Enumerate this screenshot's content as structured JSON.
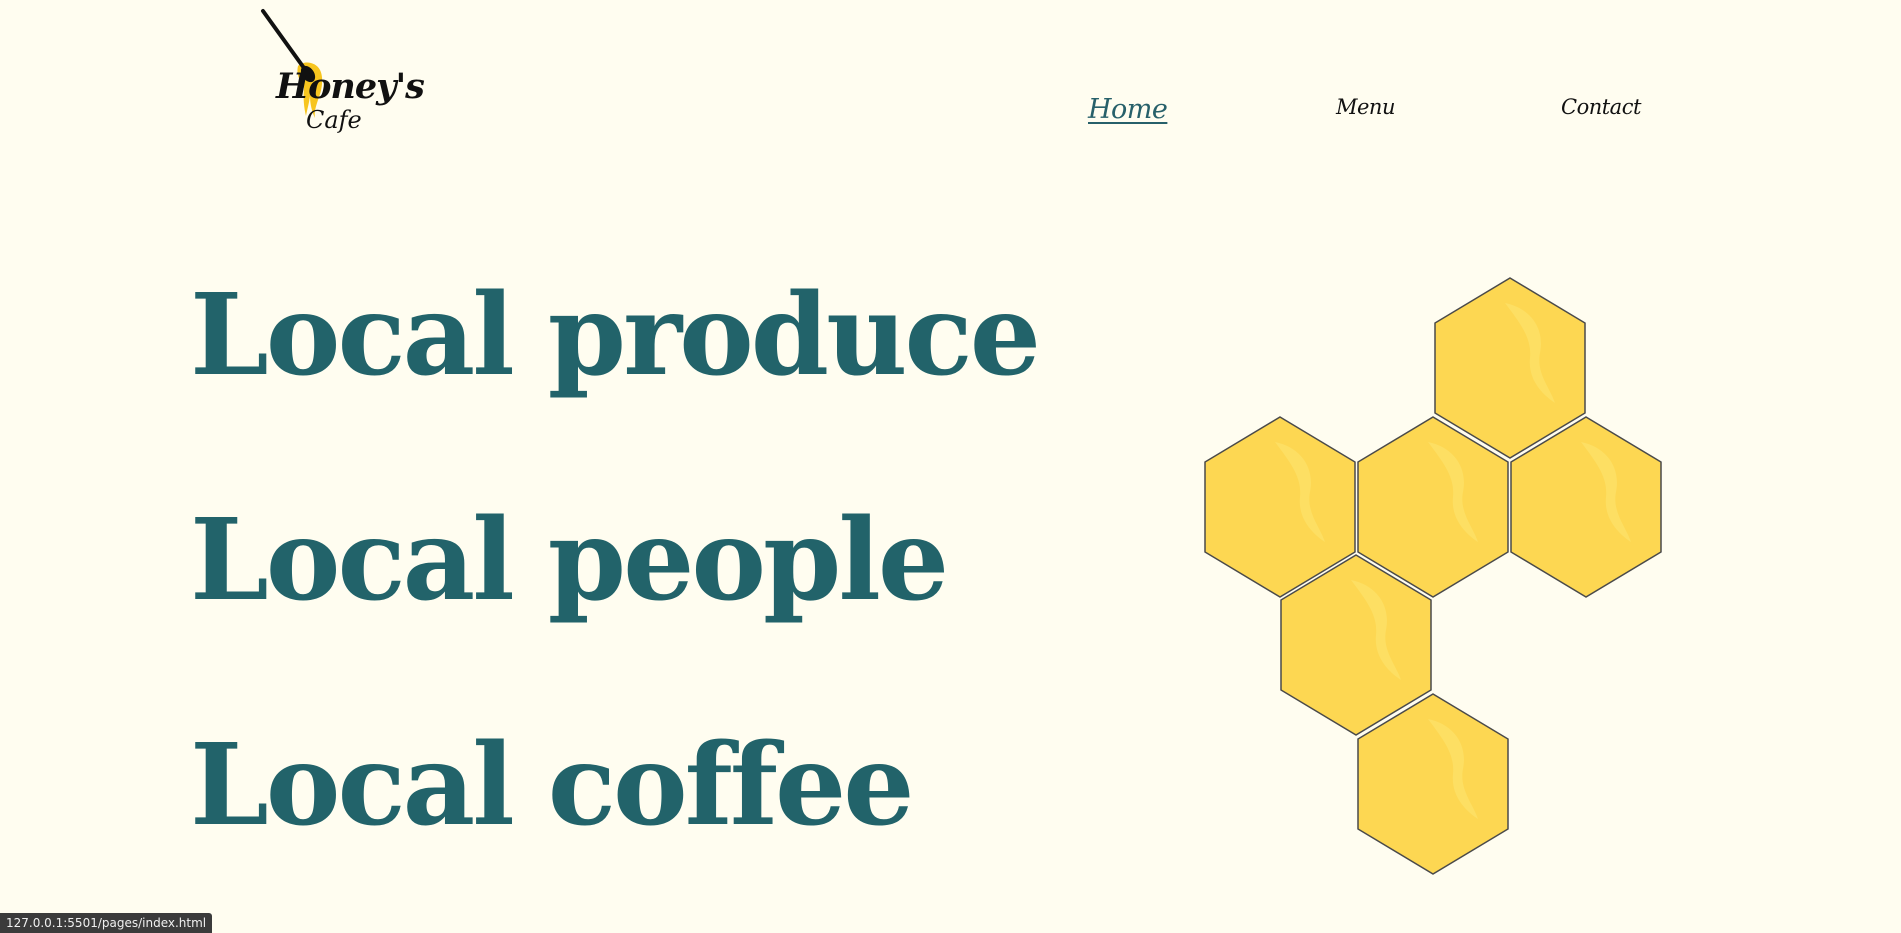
{
  "header": {
    "logo": {
      "line1": "Honey's",
      "line2": "Cafe",
      "icon": "honey-dipper-icon"
    },
    "nav": [
      {
        "label": "Home",
        "active": true
      },
      {
        "label": "Menu",
        "active": false
      },
      {
        "label": "Contact",
        "active": false
      }
    ]
  },
  "hero": {
    "taglines": [
      "Local produce",
      "Local people",
      "Local coffee"
    ],
    "decoration": "honeycomb-graphic"
  },
  "status_bar": {
    "url": "127.0.0.1:5501/pages/index.html"
  },
  "colors": {
    "background": "#fffdf0",
    "heading": "#22636a",
    "active_link": "#27606a",
    "honey": "#fdd752",
    "honey_highlight": "#fde065",
    "hex_outline": "#4a4a4a"
  }
}
